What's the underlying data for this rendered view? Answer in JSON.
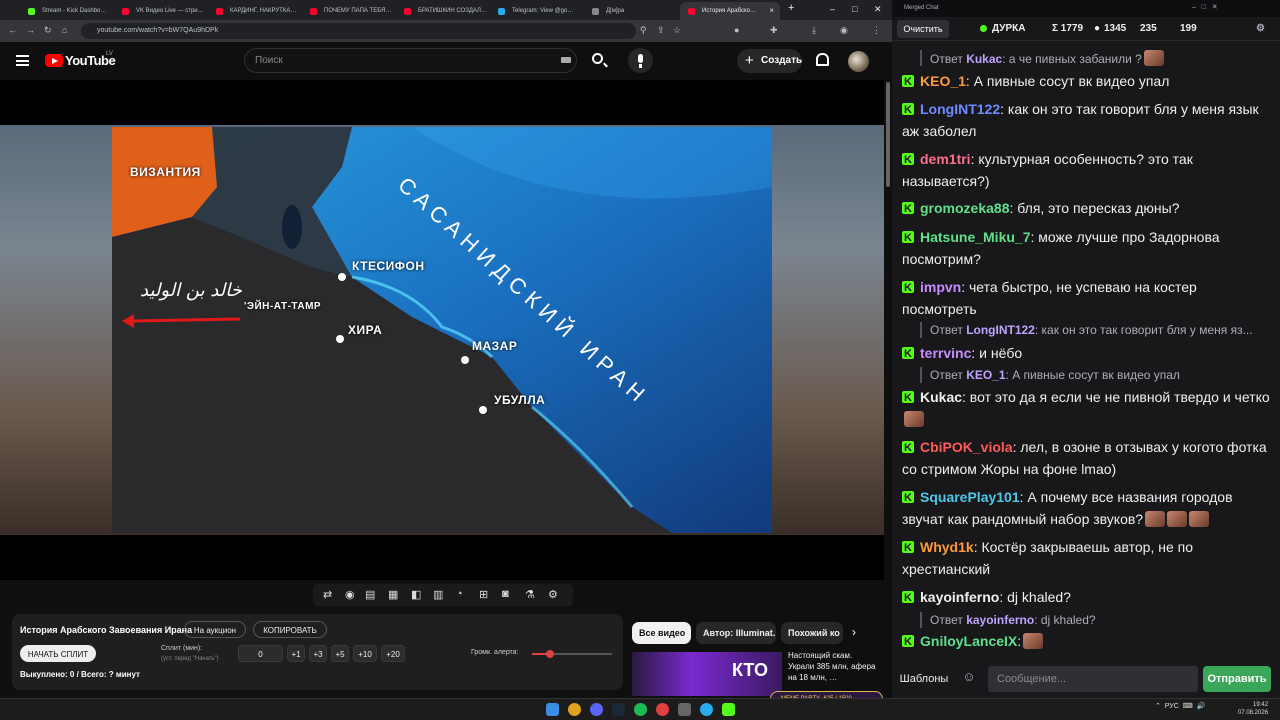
{
  "browser": {
    "tabs": [
      {
        "label": "Stream - Kick Dashbo…",
        "color": "#53fc18"
      },
      {
        "label": "VK Видео Live — стри…",
        "color": "#ff0033"
      },
      {
        "label": "КАРДИНГ, НАКРУТКА…",
        "color": "#ff0033"
      },
      {
        "label": "ПОЧЕМУ ПАПА ТЕБЯ…",
        "color": "#ff0033"
      },
      {
        "label": "БРАТИШКИН СОЗДАЛ…",
        "color": "#ff0033"
      },
      {
        "label": "Telegram: View @go…",
        "color": "#2aabee"
      },
      {
        "label": "Д[м]ра",
        "color": "#888888"
      },
      {
        "label": "История Арабско…",
        "color": "#ff0033"
      }
    ],
    "url": "youtube.com/watch?v=bW7QAu9hDPk"
  },
  "youtube": {
    "logo_text": "YouTube",
    "country": "LV",
    "search_placeholder": "Поиск",
    "create_label": "Создать"
  },
  "video": {
    "labels": {
      "byzantium": "ВИЗАНТИЯ",
      "ctesiphon": "КТЕСИФОН",
      "ain_at_tamr": "'ЭЙН-АТ-ТАМР",
      "hira": "ХИРА",
      "mazar": "МАЗАР",
      "ubulla": "УБУЛЛА",
      "sasanid": "САСАНИДСКИЙ ИРАН",
      "arabic": "خالد بن الوليد"
    }
  },
  "extension": {
    "title": "История Арабского Завоевания Ирана",
    "auction_label": "На аукцион",
    "copy_label": "КОПИРОВАТЬ",
    "start_split_label": "НАЧАТЬ СПЛИТ",
    "split_label": "Сплит (мин):",
    "split_hint": "(уст. перед \"Начать\")",
    "split_value": "0",
    "increments": [
      "+1",
      "+3",
      "+5",
      "+10",
      "+20"
    ],
    "volume_label": "Громк. алерта:",
    "bought_label": "Выкуплено: 0 / Всего: ? минут"
  },
  "recommendations": {
    "chips": [
      "Все видео",
      "Автор: Illuminat.",
      "Похожий ко"
    ],
    "thumb_text": "КТО",
    "video_title": "Настоящий скам. Украли 385 млн, афера на 18 млн, …"
  },
  "chat": {
    "window_title": "Merged Chat",
    "clear_label": "Очистить",
    "channel": "ДУРКА",
    "stats": [
      "Σ 1779",
      "1345",
      "235",
      "199"
    ],
    "messages": [
      {
        "type": "reply",
        "prefix": "Ответ",
        "user": "Kukac",
        "text": ": а че пивных забанили ?"
      },
      {
        "type": "msg",
        "user": "KEO_1",
        "color": "#ff9a3c",
        "text": ": А пивные сосут вк видео упал"
      },
      {
        "type": "msg",
        "user": "LongINT122",
        "color": "#6e8cff",
        "text": ": как он это так говорит бля у меня язык аж заболел"
      },
      {
        "type": "msg",
        "user": "dem1tri",
        "color": "#ff6e8a",
        "text": ": культурная особенность? это так называется?)"
      },
      {
        "type": "msg",
        "user": "gromozeka88",
        "color": "#5fe08a",
        "text": ": бля, это пересказ дюны?"
      },
      {
        "type": "msg",
        "user": "Hatsune_Miku_7",
        "color": "#5fe08a",
        "text": ": може лучше про Задорнова посмотрим?"
      },
      {
        "type": "msg",
        "user": "impvn",
        "color": "#c88cff",
        "text": ": чета быстро, не успеваю на костер посмотреть"
      },
      {
        "type": "reply",
        "prefix": "Ответ",
        "user": "LongINT122",
        "text": ": как он это так говорит бля у меня яз..."
      },
      {
        "type": "msg",
        "user": "terrvinc",
        "color": "#c88cff",
        "text": ": и нёбо"
      },
      {
        "type": "reply",
        "prefix": "Ответ",
        "user": "KEO_1",
        "text": ": А пивные сосут вк видео упал"
      },
      {
        "type": "msg",
        "user": "Kukac",
        "color": "#f0f0f0",
        "text": ": вот это да я если че не пивной твердо и четко"
      },
      {
        "type": "msg",
        "user": "CbiPOK_viola",
        "color": "#ff5a5a",
        "text": ": лел, в озоне в отзывах у когото фотка со стримом Жоры на фоне lmao)"
      },
      {
        "type": "msg",
        "user": "SquarePlay101",
        "color": "#4cc8e8",
        "text": ": А почему все названия городов звучат как рандомный набор звуков?"
      },
      {
        "type": "msg",
        "user": "Whyd1k",
        "color": "#ff9a3c",
        "text": ": Костёр закрываешь автор, не по хрестианский"
      },
      {
        "type": "msg",
        "user": "kayoinferno",
        "color": "#f0f0f0",
        "text": ": dj khaled?"
      },
      {
        "type": "reply",
        "prefix": "Ответ",
        "user": "kayoinferno",
        "text": ": dj khaled?"
      },
      {
        "type": "msg",
        "user": "GniloyLanceIX",
        "color": "#5fe08a",
        "text": ":"
      }
    ],
    "templates_label": "Шаблоны",
    "message_placeholder": "Сообщение...",
    "send_label": "Отправить"
  },
  "taskbar": {
    "lang": "РУС",
    "time": "19:42",
    "date": "07.08.2026",
    "widget_text": "MEME PARTY",
    "widget_counter": "625 / 1500"
  },
  "colors": {
    "kick_green": "#53fc18",
    "yt_red": "#ff0000",
    "send_green": "#3aa658"
  }
}
